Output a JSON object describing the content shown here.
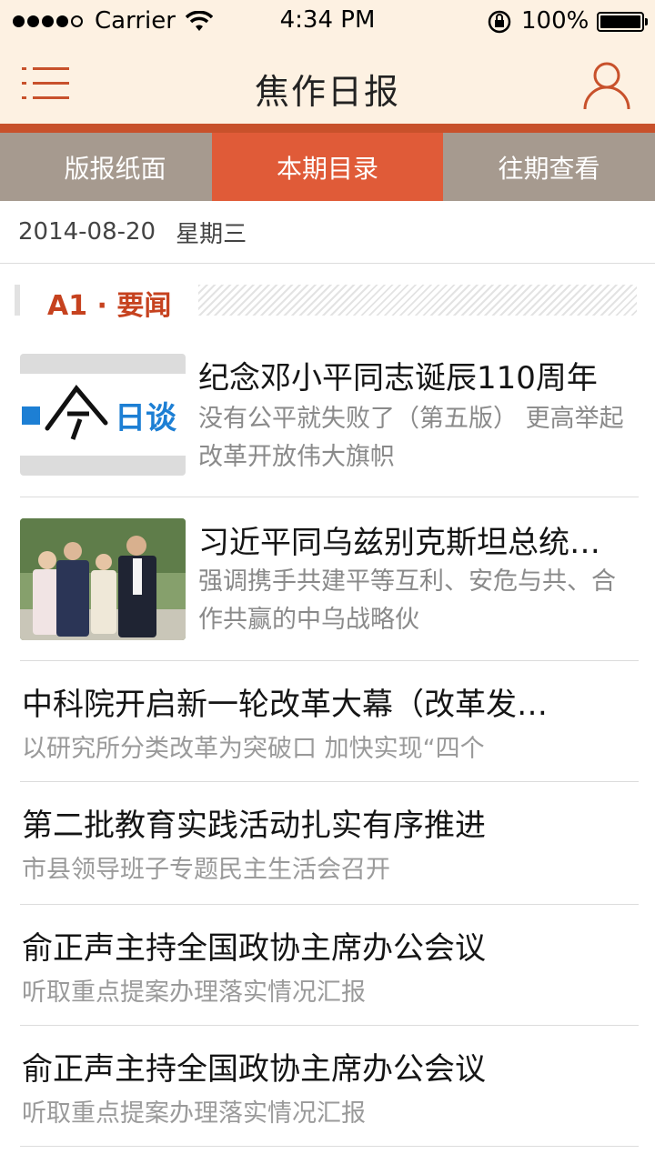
{
  "status_bar": {
    "carrier": "Carrier",
    "time": "4:34 PM",
    "battery": "100%",
    "icons": [
      "signal-icon",
      "wifi-icon",
      "rotation-lock-icon",
      "battery-icon"
    ]
  },
  "nav": {
    "title": "焦作日报",
    "menu_icon": "menu-icon",
    "user_icon": "user-icon",
    "accent_color": "#c8512b",
    "background": "#fdf1e2"
  },
  "tabs": [
    {
      "label": "版报纸面",
      "active": false
    },
    {
      "label": "本期目录",
      "active": true
    },
    {
      "label": "往期查看",
      "active": false
    }
  ],
  "tab_colors": {
    "active": "#e05b38",
    "inactive": "#a69a8f"
  },
  "issue": {
    "date": "2014-08-20",
    "weekday": "星期三"
  },
  "section": {
    "label": "A1 · 要闻"
  },
  "articles": [
    {
      "headline": "纪念邓小平同志诞辰110周年",
      "summary": "没有公平就失败了（第五版） 更高举起改革开放伟大旗帜",
      "thumbnail": {
        "type": "logo",
        "text": "今日谈"
      }
    },
    {
      "headline": "习近平同乌兹别克斯坦总统…",
      "summary": "强调携手共建平等互利、安危与共、合作共赢的中乌战略伙",
      "thumbnail": {
        "type": "photo"
      }
    },
    {
      "headline": "中科院开启新一轮改革大幕（改革发…",
      "summary": "以研究所分类改革为突破口 加快实现“四个"
    },
    {
      "headline": "第二批教育实践活动扎实有序推进",
      "summary": "市县领导班子专题民主生活会召开"
    },
    {
      "headline": "俞正声主持全国政协主席办公会议",
      "summary": "听取重点提案办理落实情况汇报"
    },
    {
      "headline": "俞正声主持全国政协主席办公会议",
      "summary": "听取重点提案办理落实情况汇报"
    }
  ]
}
